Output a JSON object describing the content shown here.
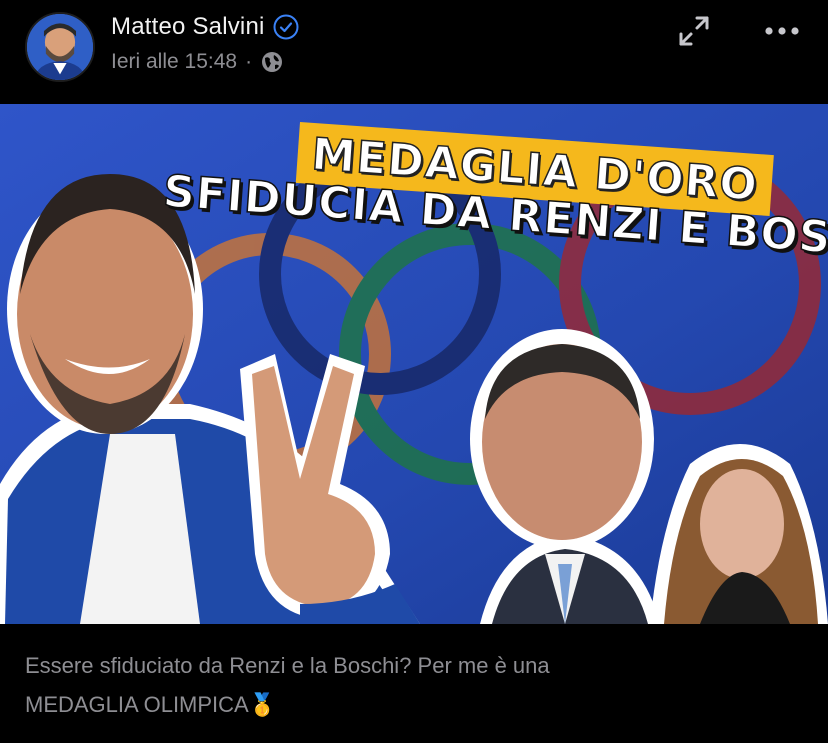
{
  "post": {
    "author": "Matteo Salvini",
    "verified": true,
    "timestamp": "Ieri alle 15:48",
    "separator": "·",
    "privacy_icon": "globe-icon",
    "actions": [
      "expand-icon",
      "more-icon"
    ]
  },
  "media": {
    "headline_line1": "MEDAGLIA D'ORO",
    "headline_line2": "SFIDUCIA DA RENZI E BOSCHI",
    "accent_color": "#f5b81c"
  },
  "caption": {
    "line1": "Essere sfiduciato da Renzi e la Boschi? Per me è una",
    "line2": "MEDAGLIA OLIMPICA",
    "emoji": "🥇"
  },
  "colors": {
    "background": "#000000",
    "verified": "#3b82f6",
    "secondary_text": "#8e8e93"
  }
}
